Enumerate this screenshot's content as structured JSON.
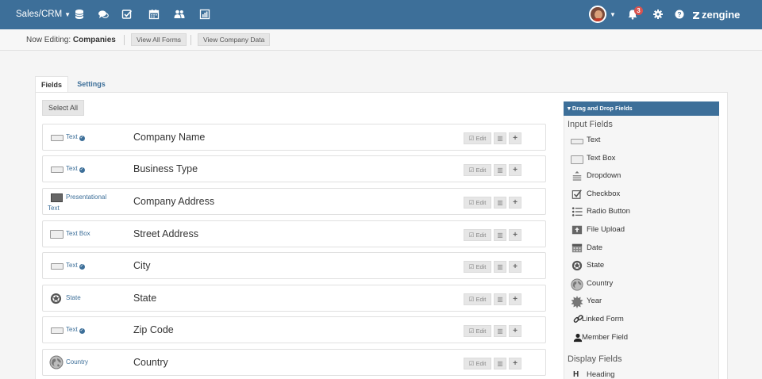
{
  "topnav": {
    "app_menu": "Sales/CRM",
    "notification_count": "3",
    "brand": "zengine"
  },
  "subheader": {
    "now_editing_label": "Now Editing:",
    "now_editing_value": "Companies",
    "view_all_forms": "View All Forms",
    "view_company_data": "View Company Data"
  },
  "tabs": {
    "fields": "Fields",
    "settings": "Settings"
  },
  "select_all": "Select All",
  "buttons": {
    "edit": "Edit",
    "delete": "🗑",
    "add": "+"
  },
  "fields": [
    {
      "type": "Text",
      "required": true,
      "icon": "text-icon",
      "name": "Company Name"
    },
    {
      "type": "Text",
      "required": true,
      "icon": "text-icon",
      "name": "Business Type"
    },
    {
      "type": "Presentational",
      "type2": "Text",
      "required": false,
      "icon": "presentational-icon",
      "name": "Company Address"
    },
    {
      "type": "Text Box",
      "required": false,
      "icon": "textbox-icon",
      "name": "Street Address"
    },
    {
      "type": "Text",
      "required": true,
      "icon": "text-icon",
      "name": "City"
    },
    {
      "type": "State",
      "required": false,
      "icon": "state-icon",
      "name": "State"
    },
    {
      "type": "Text",
      "required": true,
      "icon": "text-icon",
      "name": "Zip Code"
    },
    {
      "type": "Country",
      "required": false,
      "icon": "globe-icon",
      "name": "Country"
    }
  ],
  "sidebar": {
    "title": "▾ Drag and Drop Fields",
    "input_fields_heading": "Input Fields",
    "input_fields": [
      {
        "label": "Text",
        "icon": "text-icon"
      },
      {
        "label": "Text Box",
        "icon": "textbox-icon"
      },
      {
        "label": "Dropdown",
        "icon": "dropdown-icon"
      },
      {
        "label": "Checkbox",
        "icon": "checkbox-icon"
      },
      {
        "label": "Radio Button",
        "icon": "radio-list-icon"
      },
      {
        "label": "File Upload",
        "icon": "file-upload-icon"
      },
      {
        "label": "Date",
        "icon": "calendar-icon"
      },
      {
        "label": "State",
        "icon": "state-icon"
      },
      {
        "label": "Country",
        "icon": "globe-icon"
      },
      {
        "label": "Year",
        "icon": "year-icon"
      },
      {
        "label": "Linked Form",
        "icon": "link-icon"
      },
      {
        "label": "Member Field",
        "icon": "user-icon"
      }
    ],
    "display_fields_heading": "Display Fields",
    "display_fields": [
      {
        "label": "Heading",
        "icon": "heading-icon"
      }
    ]
  },
  "colors": {
    "nav": "#3d6f99",
    "accent": "#3d6f99",
    "badge": "#d9534f"
  }
}
